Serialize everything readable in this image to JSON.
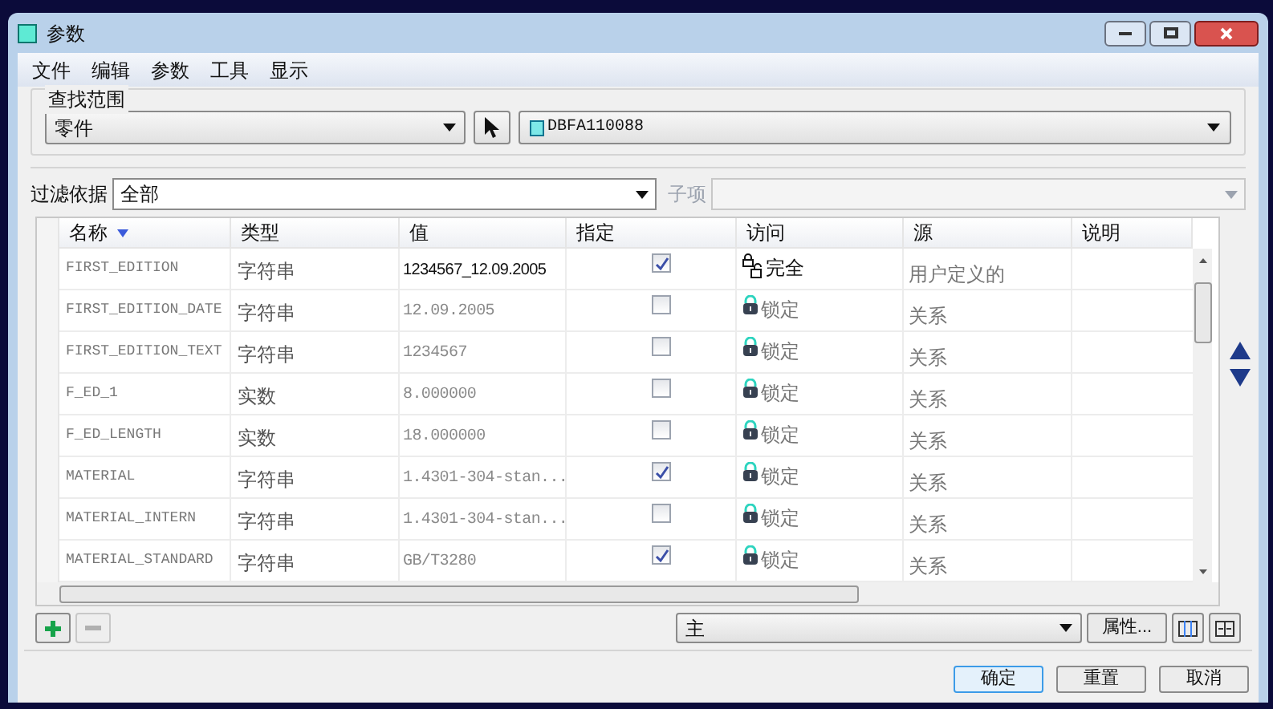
{
  "window": {
    "title": "参数"
  },
  "menu": [
    "文件",
    "编辑",
    "参数",
    "工具",
    "显示"
  ],
  "scope": {
    "label": "查找范围",
    "type_value": "零件",
    "model_value": "DBFA110088"
  },
  "filter": {
    "label": "过滤依据",
    "value": "全部",
    "sub_label": "子项"
  },
  "table": {
    "columns": [
      {
        "label": "名称",
        "sorted": true
      },
      {
        "label": "类型",
        "sorted": false
      },
      {
        "label": "值",
        "sorted": false
      },
      {
        "label": "指定",
        "sorted": false
      },
      {
        "label": "访问",
        "sorted": false
      },
      {
        "label": "源",
        "sorted": false
      },
      {
        "label": "说明",
        "sorted": false
      }
    ],
    "rows": [
      {
        "name": "FIRST_EDITION",
        "type": "字符串",
        "value": "1234567_12.09.2005",
        "editable": true,
        "designated": true,
        "kind": "full",
        "access": "完全",
        "source": "用户定义的"
      },
      {
        "name": "FIRST_EDITION_DATE",
        "type": "字符串",
        "value": "12.09.2005",
        "editable": false,
        "designated": false,
        "kind": "locked",
        "access": "锁定",
        "source": "关系"
      },
      {
        "name": "FIRST_EDITION_TEXT",
        "type": "字符串",
        "value": "1234567",
        "editable": false,
        "designated": false,
        "kind": "locked",
        "access": "锁定",
        "source": "关系"
      },
      {
        "name": "F_ED_1",
        "type": "实数",
        "value": "8.000000",
        "editable": false,
        "designated": false,
        "kind": "locked",
        "access": "锁定",
        "source": "关系"
      },
      {
        "name": "F_ED_LENGTH",
        "type": "实数",
        "value": "18.000000",
        "editable": false,
        "designated": false,
        "kind": "locked",
        "access": "锁定",
        "source": "关系"
      },
      {
        "name": "MATERIAL",
        "type": "字符串",
        "value": "1.4301-304-stan...",
        "editable": false,
        "designated": true,
        "kind": "locked",
        "access": "锁定",
        "source": "关系"
      },
      {
        "name": "MATERIAL_INTERN",
        "type": "字符串",
        "value": "1.4301-304-stan...",
        "editable": false,
        "designated": false,
        "kind": "locked",
        "access": "锁定",
        "source": "关系"
      },
      {
        "name": "MATERIAL_STANDARD",
        "type": "字符串",
        "value": "GB/T3280",
        "editable": false,
        "designated": true,
        "kind": "locked",
        "access": "锁定",
        "source": "关系"
      }
    ]
  },
  "bottom": {
    "view_value": "主",
    "properties_button": "属性..."
  },
  "buttons": [
    {
      "label": "确定",
      "selected": true
    },
    {
      "label": "重置",
      "selected": false
    },
    {
      "label": "取消",
      "selected": false
    }
  ]
}
